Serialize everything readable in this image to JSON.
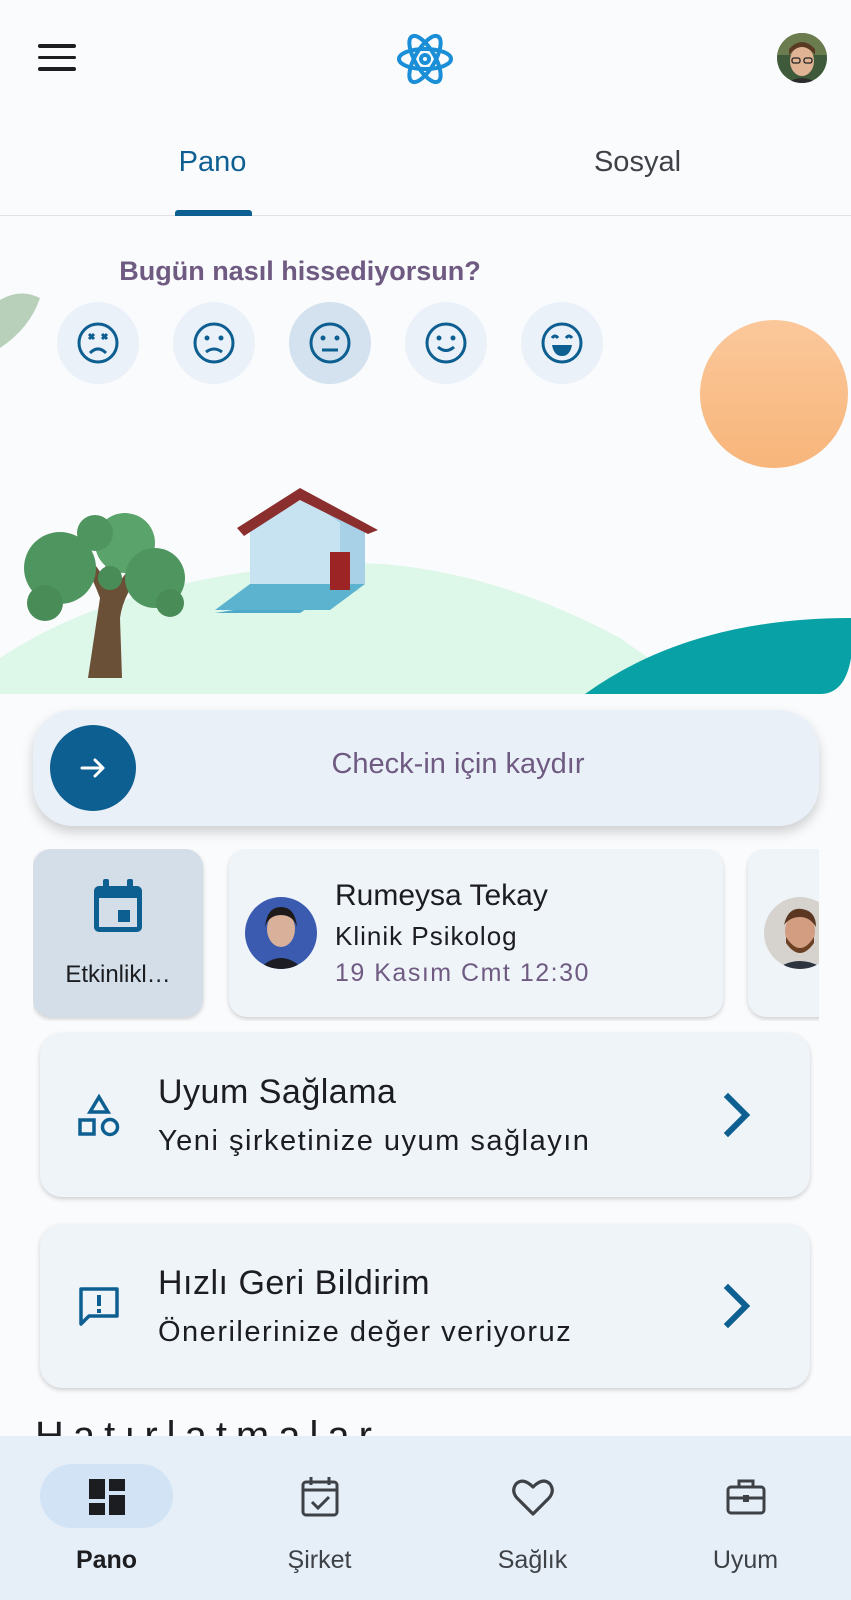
{
  "header": {
    "menu_icon": "hamburger-menu-icon",
    "logo_icon": "atom-logo-icon",
    "avatar_icon": "user-avatar"
  },
  "tabs": [
    {
      "label": "Pano",
      "active": true
    },
    {
      "label": "Sosyal",
      "active": false
    }
  ],
  "mood": {
    "question": "Bugün nasıl hissediyorsun?",
    "options": [
      {
        "icon": "very-sad-face-icon"
      },
      {
        "icon": "sad-face-icon"
      },
      {
        "icon": "neutral-face-icon",
        "selected": true
      },
      {
        "icon": "happy-face-icon"
      },
      {
        "icon": "very-happy-face-icon"
      }
    ]
  },
  "checkin": {
    "label": "Check-in için kaydır",
    "icon": "arrow-right-icon"
  },
  "carousel": {
    "events": {
      "label": "Etkinlikl…",
      "icon": "calendar-icon"
    },
    "appointment": {
      "name": "Rumeysa Tekay",
      "role": "Klinik Psikolog",
      "time": "19 Kasım Cmt 12:30"
    }
  },
  "cards": [
    {
      "title": "Uyum Sağlama",
      "subtitle": "Yeni şirketinize uyum sağlayın",
      "icon": "shapes-icon"
    },
    {
      "title": "Hızlı Geri Bildirim",
      "subtitle": "Önerilerinize değer veriyoruz",
      "icon": "feedback-icon"
    }
  ],
  "partial_heading": "Hatırlatmalar",
  "bottom_nav": [
    {
      "label": "Pano",
      "icon": "dashboard-icon",
      "active": true
    },
    {
      "label": "Şirket",
      "icon": "calendar-check-icon",
      "active": false
    },
    {
      "label": "Sağlık",
      "icon": "heart-icon",
      "active": false
    },
    {
      "label": "Uyum",
      "icon": "briefcase-icon",
      "active": false
    }
  ],
  "colors": {
    "primary": "#0e5f91",
    "accent_text": "#6f5a82",
    "background": "#fafbfd",
    "card": "#eff4f9",
    "nav_background": "#e6eef7"
  }
}
